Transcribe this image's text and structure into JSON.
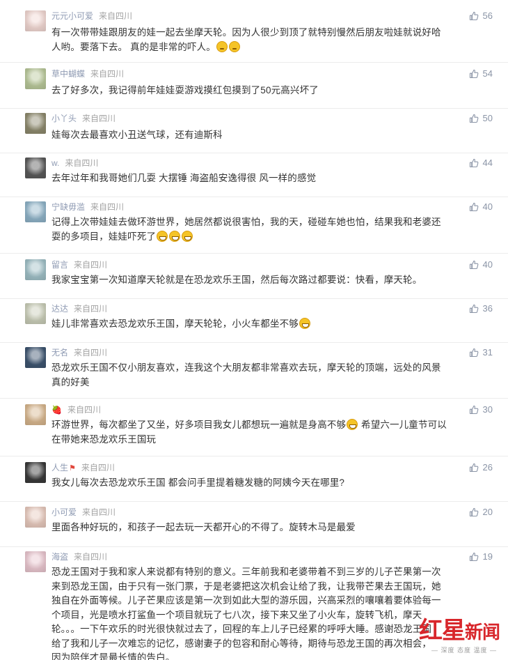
{
  "comments": [
    {
      "user": "元元小可爱",
      "source": "来自四川",
      "likes": "56",
      "avatar_color": "#f1d7d2",
      "avatar_icon": "pink-cartoon-avatar",
      "text_lines": [
        "有一次带带娃跟朋友的娃一起去坐摩天轮。因为人很少到顶了就特别慢然后朋友啦娃就说好哈",
        "人哟。要落下去。 真的是非常的吓人。"
      ],
      "emoji_count": 2,
      "emoji_type": "think"
    },
    {
      "user": "草中蝴蝶",
      "source": "来自四川",
      "likes": "54",
      "avatar_color": "#b9c89a",
      "avatar_icon": "butterfly-photo-avatar",
      "text_lines": [
        "去了好多次，我记得前年娃娃耍游戏摸红包摸到了50元高兴坏了"
      ]
    },
    {
      "user": "小丫头",
      "source": "来自四川",
      "likes": "50",
      "avatar_color": "#8e8a6e",
      "avatar_icon": "group-photo-avatar",
      "text_lines": [
        "娃每次去最喜欢小丑送气球，还有迪斯科"
      ]
    },
    {
      "user": "w.",
      "source": "来自四川",
      "likes": "44",
      "avatar_color": "#5a5a5a",
      "avatar_icon": "girl-photo-avatar",
      "text_lines": [
        "去年过年和我哥她们几耍 大摆锤 海盗船安逸得很 风一样的感觉"
      ]
    },
    {
      "user": "宁缺毋滥",
      "source": "来自四川",
      "likes": "40",
      "avatar_color": "#8fb3c8",
      "avatar_icon": "landscape-avatar",
      "text_lines": [
        "记得上次带娃娃去做环游世界，她居然都说很害怕，我的天，碰碰车她也怕，结果我和老婆还",
        "耍的多项目，娃娃吓死了"
      ],
      "emoji_count": 3,
      "emoji_type": "grin"
    },
    {
      "user": "留言",
      "source": "来自四川",
      "likes": "40",
      "avatar_color": "#9fbfc6",
      "avatar_icon": "sky-photo-avatar",
      "text_lines": [
        "我家宝宝第一次知道摩天轮就是在恐龙欢乐王国，然后每次路过都要说：快看，摩天轮。"
      ]
    },
    {
      "user": "达达",
      "source": "来自四川",
      "likes": "36",
      "avatar_color": "#c9cdb8",
      "avatar_icon": "puppy-avatar",
      "text_lines": [
        "娃儿非常喜欢去恐龙欢乐王国，摩天轮轮，小火车都坐不够"
      ],
      "emoji_count": 1,
      "emoji_type": "grin"
    },
    {
      "user": "无名",
      "source": "来自四川",
      "likes": "31",
      "avatar_color": "#3e5570",
      "avatar_icon": "sunset-avatar",
      "text_lines": [
        "恐龙欢乐王国不仅小朋友喜欢，连我这个大朋友都非常喜欢去玩，摩天轮的顶端，远处的风景",
        "真的好美"
      ]
    },
    {
      "user": "",
      "user_icon": "strawberry",
      "source": "来自四川",
      "likes": "30",
      "avatar_color": "#d7b68e",
      "avatar_icon": "baby-photo-avatar",
      "text_lines": [
        "环游世界，每次都坐了又坐，好多项目我女儿都想玩一遍就是身高不够",
        "在带她来恐龙欢乐王国玩"
      ],
      "first_line_suffix": " 希望六一儿童节可以",
      "emoji_count": 1,
      "emoji_type": "grin"
    },
    {
      "user": "人生",
      "user_flag": "⚑",
      "source": "来自四川",
      "likes": "26",
      "avatar_color": "#3a3a3a",
      "avatar_icon": "dark-portrait-avatar",
      "text_lines": [
        " 我女儿每次去恐龙欢乐王国 都会问手里提着糖发糖的阿姨今天在哪里?"
      ]
    },
    {
      "user": "小可爱",
      "source": "来自四川",
      "likes": "20",
      "avatar_color": "#e7c9bd",
      "avatar_icon": "toddler-avatar",
      "text_lines": [
        "里面各种好玩的，和孩子一起去玩一天都开心的不得了。旋转木马是最爱"
      ]
    },
    {
      "user": "海盗",
      "source": "来自四川",
      "likes": "19",
      "avatar_color": "#e9c6cf",
      "avatar_icon": "pink-baby-avatar",
      "text_lines": [
        "恐龙王国对于我和家人来说都有特别的意义。三年前我和老婆带着不到三岁的儿子芒果第一次",
        "来到恐龙王国，由于只有一张门票，于是老婆把这次机会让给了我，让我带芒果去王国玩，她",
        "独自在外面等候。儿子芒果应该是第一次到如此大型的游乐园，兴高采烈的嚷嚷着要体验每一",
        "个项目，光是喷水打鲨鱼一个项目就玩了七八次，接下来又坐了小火车，旋转飞机，摩天",
        "轮。。。一下午欢乐的时光很快就过去了，回程的车上儿子已经累的呼呼大睡。感谢恐龙王国",
        "给了我和儿子一次难忘的记忆，感谢妻子的包容和耐心等待，期待与恐龙王国的再次相会，",
        "因为陪伴才是最长情的告白。"
      ]
    }
  ],
  "watermark": {
    "logo_left": "红",
    "logo_mid": "星",
    "logo_right": "新闻",
    "tagline": "— 深度 态度 温度 —"
  },
  "colors": {
    "username": "#8f9bb3",
    "source": "#a3a3a3",
    "body_text": "#333333",
    "likes": "#8a94a6",
    "divider": "#ececec",
    "watermark_red": "#d8262b"
  }
}
